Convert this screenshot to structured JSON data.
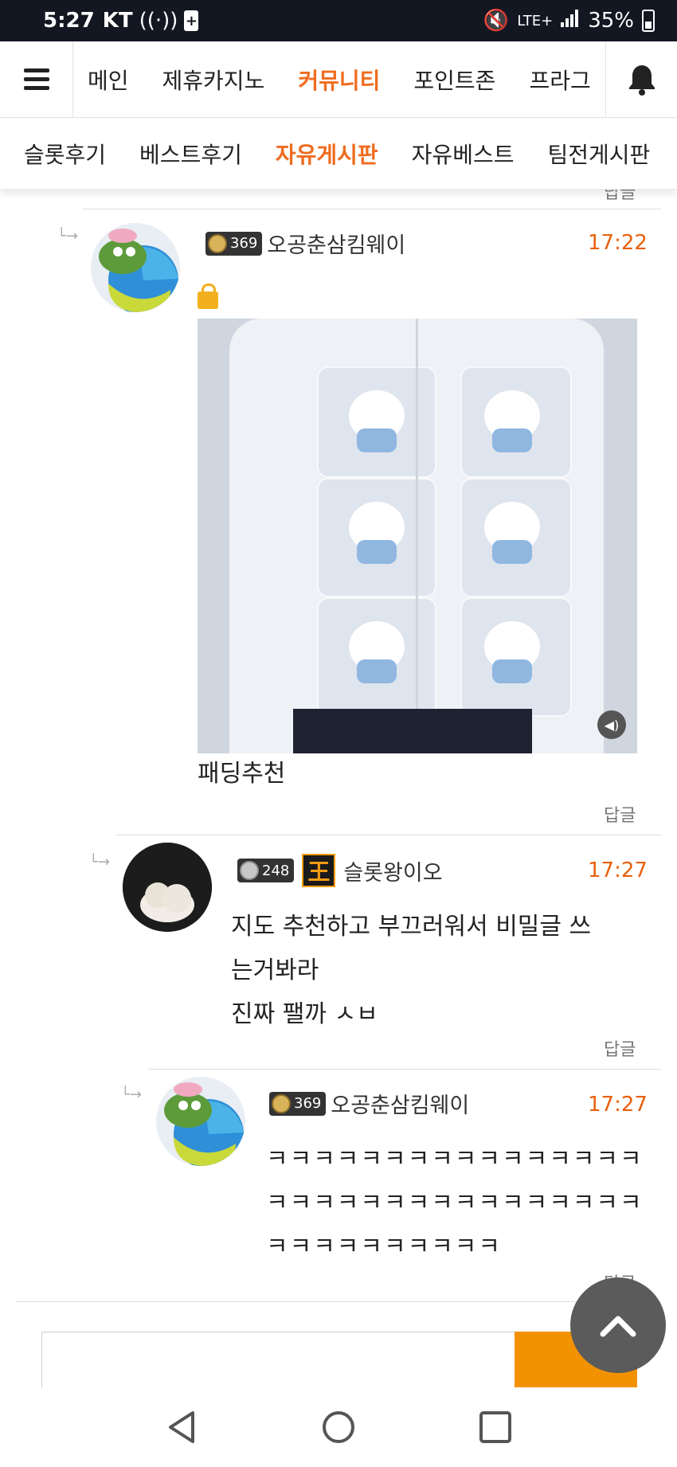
{
  "status": {
    "time": "5:27",
    "carrier": "KT",
    "network": "LTE+",
    "battery": "35%"
  },
  "nav_main": {
    "tabs": [
      "메인",
      "제휴카지노",
      "커뮤니티",
      "포인트존",
      "프라그"
    ],
    "active_index": 2
  },
  "nav_sub": {
    "tabs": [
      "슬롯후기",
      "베스트후기",
      "자유게시판",
      "자유베스트",
      "팀전게시판"
    ],
    "active_index": 2
  },
  "truncated_reply": "답글",
  "comments": [
    {
      "level": "369",
      "username": "오공춘삼킴웨이",
      "time": "17:22",
      "secret": true,
      "body": "패딩추천",
      "reply": "답글"
    },
    {
      "level": "248",
      "badge": "王",
      "username": "슬롯왕이오",
      "time": "17:27",
      "body_lines": [
        "지도 추천하고 부끄러워서 비밀글 쓰",
        "는거봐라",
        "진짜 팰까 ㅅㅂ"
      ],
      "reply": "답글"
    },
    {
      "level": "369",
      "username": "오공춘삼킴웨이",
      "time": "17:27",
      "body_lines": [
        "ㅋㅋㅋㅋㅋㅋㅋㅋㅋㅋㅋㅋㅋㅋㅋㅋ",
        "ㅋㅋㅋㅋㅋㅋㅋㅋㅋㅋㅋㅋㅋㅋㅋㅋ",
        "ㅋㅋㅋㅋㅋㅋㅋㅋㅋㅋ"
      ],
      "reply": "답글"
    }
  ],
  "colors": {
    "accent": "#ef6c1f",
    "time": "#e8600d",
    "submit": "#f39200",
    "status_bar": "#131722"
  }
}
